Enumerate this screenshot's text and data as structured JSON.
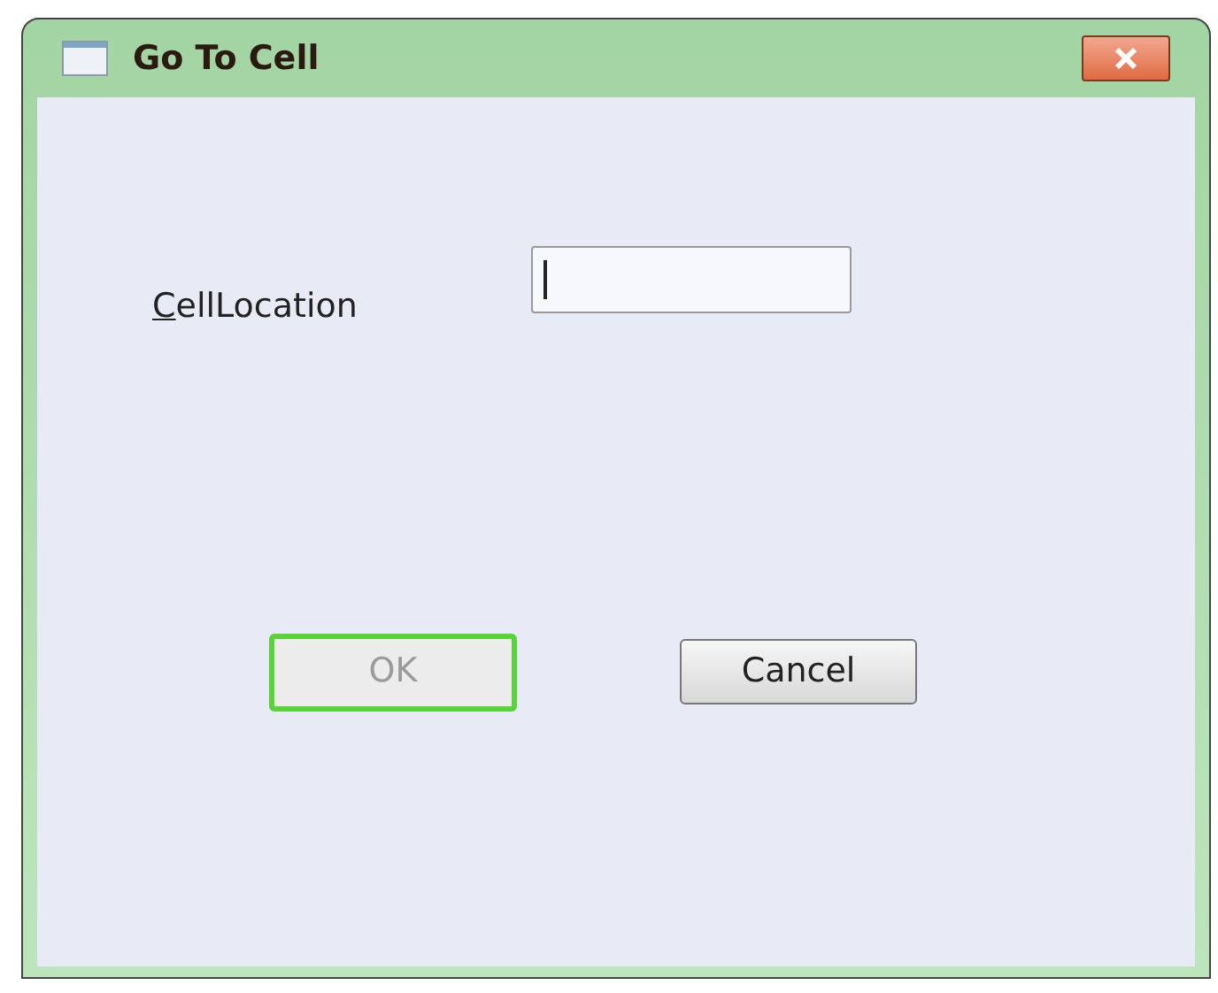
{
  "window": {
    "title": "Go To Cell"
  },
  "field": {
    "label": "CellLocation",
    "mnemonic_underlined": true,
    "focused": true
  },
  "buttons": [
    {
      "label": "OK",
      "disabled": true,
      "focused": true
    },
    {
      "label": "Cancel",
      "disabled": false,
      "focused": false
    }
  ]
}
